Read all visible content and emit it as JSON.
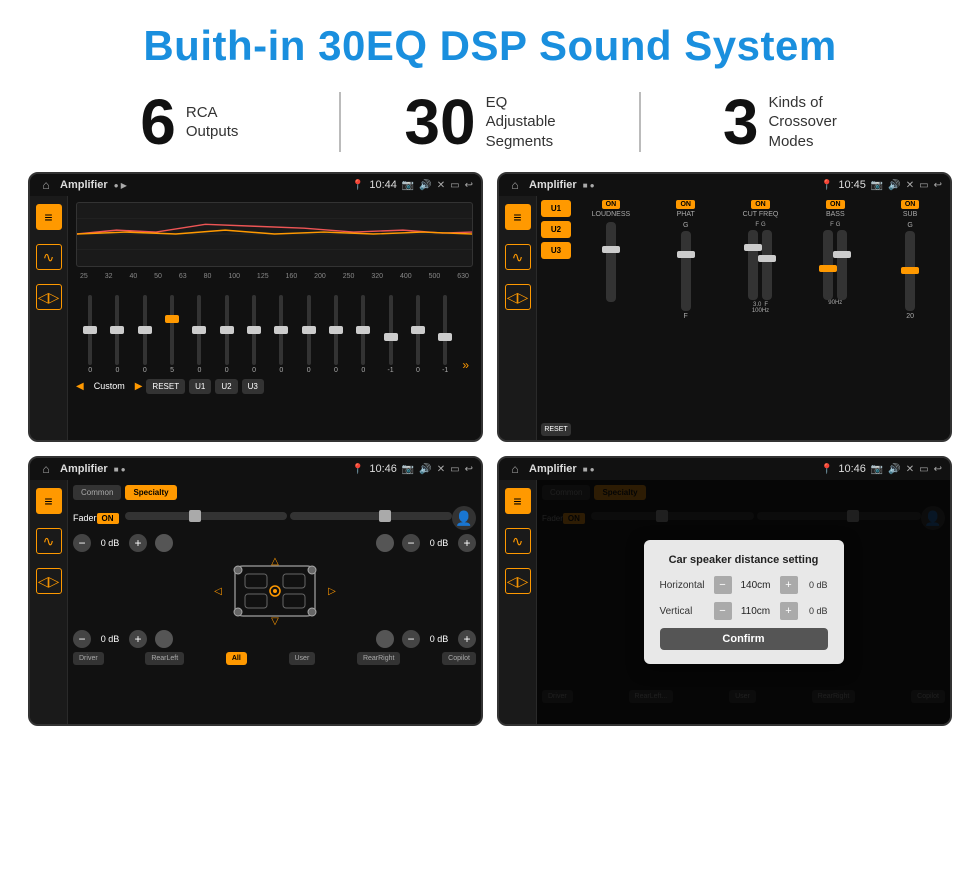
{
  "header": {
    "title": "Buith-in 30EQ DSP Sound System"
  },
  "stats": [
    {
      "number": "6",
      "label": "RCA\nOutputs"
    },
    {
      "number": "30",
      "label": "EQ Adjustable\nSegments"
    },
    {
      "number": "3",
      "label": "Kinds of\nCrossover Modes"
    }
  ],
  "screens": [
    {
      "id": "eq-screen",
      "status_bar": {
        "app": "Amplifier",
        "time": "10:44",
        "icons": "🏠"
      },
      "type": "eq"
    },
    {
      "id": "crossover-screen",
      "status_bar": {
        "app": "Amplifier",
        "time": "10:45"
      },
      "type": "crossover"
    },
    {
      "id": "fader-screen",
      "status_bar": {
        "app": "Amplifier",
        "time": "10:46"
      },
      "type": "fader"
    },
    {
      "id": "distance-screen",
      "status_bar": {
        "app": "Amplifier",
        "time": "10:46"
      },
      "type": "distance"
    }
  ],
  "eq": {
    "frequencies": [
      "25",
      "32",
      "40",
      "50",
      "63",
      "80",
      "100",
      "125",
      "160",
      "200",
      "250",
      "320",
      "400",
      "500",
      "630"
    ],
    "values": [
      "0",
      "0",
      "0",
      "5",
      "0",
      "0",
      "0",
      "0",
      "0",
      "0",
      "0",
      "-1",
      "0",
      "-1"
    ],
    "preset": "Custom",
    "buttons": [
      "RESET",
      "U1",
      "U2",
      "U3"
    ]
  },
  "crossover": {
    "presets": [
      "U1",
      "U2",
      "U3"
    ],
    "channels": [
      {
        "label": "LOUDNESS",
        "on": true
      },
      {
        "label": "PHAT",
        "on": true
      },
      {
        "label": "CUT FREQ",
        "on": true
      },
      {
        "label": "BASS",
        "on": true
      },
      {
        "label": "SUB",
        "on": true
      }
    ]
  },
  "fader": {
    "tabs": [
      "Common",
      "Specialty"
    ],
    "active_tab": "Specialty",
    "fader_label": "Fader",
    "fader_on": "ON",
    "volumes": [
      "0 dB",
      "0 dB",
      "0 dB",
      "0 dB"
    ],
    "bottom_buttons": [
      "Driver",
      "RearLeft",
      "All",
      "User",
      "RearRight",
      "Copilot"
    ]
  },
  "distance": {
    "tabs": [
      "Common",
      "Specialty"
    ],
    "modal": {
      "title": "Car speaker distance setting",
      "horizontal_label": "Horizontal",
      "horizontal_value": "140cm",
      "vertical_label": "Vertical",
      "vertical_value": "110cm",
      "right_val_h": "0 dB",
      "right_val_v": "0 dB",
      "confirm_label": "Confirm"
    }
  }
}
